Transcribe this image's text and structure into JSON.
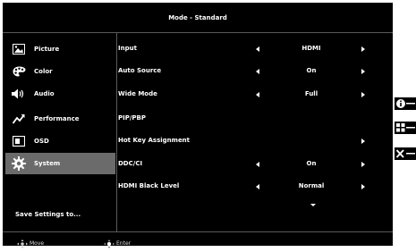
{
  "header": {
    "title": "Mode - Standard"
  },
  "sidebar": {
    "items": [
      {
        "label": "Picture",
        "icon": "picture-icon"
      },
      {
        "label": "Color",
        "icon": "palette-icon"
      },
      {
        "label": "Audio",
        "icon": "speaker-icon"
      },
      {
        "label": "Performance",
        "icon": "performance-icon"
      },
      {
        "label": "OSD",
        "icon": "osd-icon"
      },
      {
        "label": "System",
        "icon": "gear-icon",
        "active": true
      }
    ],
    "save_label": "Save Settings to..."
  },
  "settings": {
    "rows": [
      {
        "label": "Input",
        "value": "HDMI"
      },
      {
        "label": "Auto Source",
        "value": "On"
      },
      {
        "label": "Wide Mode",
        "value": "Full"
      },
      {
        "label": "PIP/PBP",
        "value": ""
      },
      {
        "label": "Hot Key Assignment",
        "value": ""
      },
      {
        "label": "DDC/CI",
        "value": "On"
      },
      {
        "label": "HDMI Black Level",
        "value": "Normal"
      }
    ]
  },
  "footer": {
    "move_label": "Move",
    "enter_label": "Enter"
  },
  "side_keys": [
    "info-icon",
    "menu-grid-icon",
    "close-icon"
  ],
  "colors": {
    "background": "#000000",
    "active_item": "#6b6b6b",
    "divider": "#5a5a5a"
  }
}
